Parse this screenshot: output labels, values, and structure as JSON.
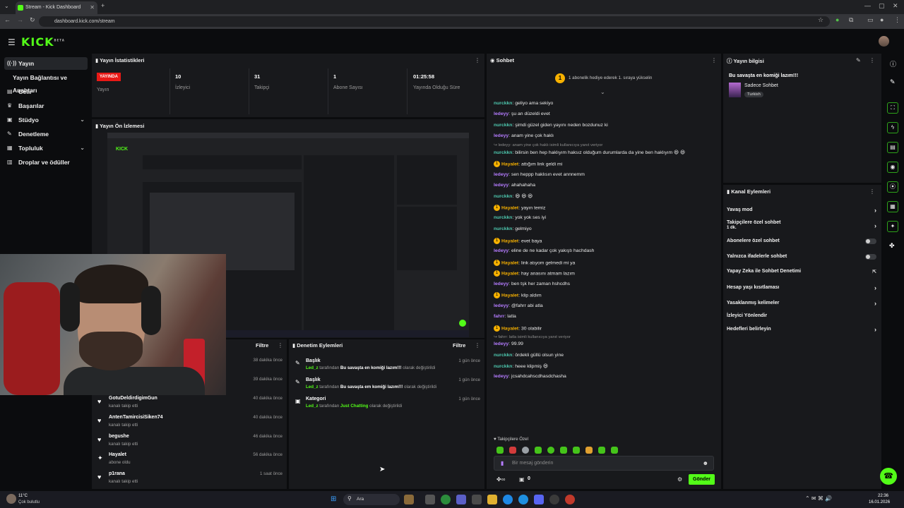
{
  "browser": {
    "tab_title": "Stream - Kick Dashboard",
    "url": "dashboard.kick.com/stream"
  },
  "header": {
    "logo": "KICK",
    "logo_sup": "BETA"
  },
  "sidebar": {
    "items": [
      {
        "label": "Yayın",
        "icon": "broadcast-icon"
      },
      {
        "label": "Yayın Bağlantısı ve Anahtarı",
        "icon": ""
      },
      {
        "label": "Gelir",
        "icon": "money-icon"
      },
      {
        "label": "Başarılar",
        "icon": "trophy-icon"
      },
      {
        "label": "Stüdyo",
        "icon": "studio-icon"
      },
      {
        "label": "Denetleme",
        "icon": "wrench-icon"
      },
      {
        "label": "Topluluk",
        "icon": "community-icon"
      },
      {
        "label": "Droplar ve ödüller",
        "icon": "gift-icon"
      }
    ]
  },
  "stats": {
    "title": "Yayın İstatistikleri",
    "live_badge": "YAYINDA",
    "live_label": "Yayın",
    "items": [
      {
        "value": "10",
        "label": "İzleyici"
      },
      {
        "value": "31",
        "label": "Takipçi"
      },
      {
        "value": "1",
        "label": "Abone Sayısı"
      },
      {
        "value": "01:25:58",
        "label": "Yayında Olduğu Süre"
      }
    ]
  },
  "preview": {
    "title": "Yayın Ön İzlemesi"
  },
  "activity": {
    "filter": "Filtre",
    "items": [
      {
        "name": "",
        "sub": "",
        "time": "38 dakika önce"
      },
      {
        "name": "",
        "sub": "",
        "time": "39 dakika önce"
      },
      {
        "name": "GotuDeldirdigimGun",
        "sub": "kanalı takip etti",
        "time": "40 dakika önce"
      },
      {
        "name": "AntenTamircisiSiken74",
        "sub": "kanalı takip etti",
        "time": "40 dakika önce"
      },
      {
        "name": "begushe",
        "sub": "kanalı takip etti",
        "time": "46 dakika önce"
      },
      {
        "name": "Hayalet",
        "sub": "abone oldu",
        "time": "56 dakika önce"
      },
      {
        "name": "p1rana",
        "sub": "kanalı takip etti",
        "time": "1 saat önce"
      }
    ]
  },
  "mod_actions": {
    "title": "Denetim Eylemleri",
    "filter": "Filtre",
    "items": [
      {
        "type": "Başlık",
        "user": "Led_z",
        "mid": "tarafından",
        "value": "Bu savaşta en komiği lazım!!!",
        "end": "olarak değiştirildi",
        "time": "1 gün önce"
      },
      {
        "type": "Başlık",
        "user": "Led_z",
        "mid": "tarafından",
        "value": "Bu savaşta em komiği lazım!!!",
        "end": "olarak değiştirildi",
        "time": "1 gün önce"
      },
      {
        "type": "Kategori",
        "user": "Led_z",
        "mid": "tarafından",
        "value": "Just Chatting",
        "end": "olarak değiştirildi",
        "time": "1 gün önce"
      }
    ]
  },
  "chat": {
    "title": "Sohbet",
    "pinned": "1 abonelik hediye ederek 1. sıraya yükselin",
    "messages": [
      {
        "user": "nurckkn",
        "color": "#4ec9b0",
        "text": "geliyo ama sekiyo"
      },
      {
        "user": "ledeyy",
        "color": "#b57cff",
        "text": "şu an düzeldi evet"
      },
      {
        "user": "nurckkn",
        "color": "#4ec9b0",
        "text": "şimdi güzel giden yayını neden bozdunuz ki"
      },
      {
        "user": "ledeyy",
        "color": "#b57cff",
        "text": "anam yine çok haklı"
      },
      {
        "reply": "ledeyy: anam yine çok haklı isimli kullanıcıya yanıt veriyor"
      },
      {
        "user": "nurckkn",
        "color": "#4ec9b0",
        "text": "bilirsin ben hep haklıyım haksız olduğum durumlarda da yine ben haklıyım 😆 😆"
      },
      {
        "user": "Hayalet",
        "color": "#f7b100",
        "badge": true,
        "text": "attığım link geldi mi"
      },
      {
        "user": "ledeyy",
        "color": "#b57cff",
        "text": "sen heppp haklısın evet annnemm"
      },
      {
        "user": "ledeyy",
        "color": "#b57cff",
        "text": "ahahahaha"
      },
      {
        "user": "nurckkn",
        "color": "#4ec9b0",
        "text": "😆 😆 😆"
      },
      {
        "user": "Hayalet",
        "color": "#f7b100",
        "badge": true,
        "text": "yayın temiz"
      },
      {
        "user": "nurckkn",
        "color": "#4ec9b0",
        "text": "yok yok ses iyi"
      },
      {
        "user": "nurckkn",
        "color": "#4ec9b0",
        "text": "gelmiyo"
      },
      {
        "user": "Hayalet",
        "color": "#f7b100",
        "badge": true,
        "text": "evet baya"
      },
      {
        "user": "ledeyy",
        "color": "#b57cff",
        "text": "eline de ne kadar çok yakıştı hachdash"
      },
      {
        "user": "Hayalet",
        "color": "#f7b100",
        "badge": true,
        "text": "link atıyom gelmedi mi ya"
      },
      {
        "user": "Hayalet",
        "color": "#f7b100",
        "badge": true,
        "text": "hay anasını atmam lazım"
      },
      {
        "user": "ledeyy",
        "color": "#b57cff",
        "text": "ben tşk her zaman hshcdhs"
      },
      {
        "user": "Hayalet",
        "color": "#f7b100",
        "badge": true,
        "text": "klip aldım"
      },
      {
        "user": "ledeyy",
        "color": "#b57cff",
        "text": "@fahrr abi atla"
      },
      {
        "user": "fahrr",
        "color": "#b57cff",
        "text": "latla"
      },
      {
        "user": "Hayalet",
        "color": "#f7b100",
        "badge": true,
        "text": "30 olabilir"
      },
      {
        "reply": "fahrr: latla isimli kullanıcıya yanıt veriyor"
      },
      {
        "user": "ledeyy",
        "color": "#b57cff",
        "text": "99.99"
      },
      {
        "user": "nurckkn",
        "color": "#4ec9b0",
        "text": "ördekli güllü olsun yine"
      },
      {
        "user": "nurckkn",
        "color": "#4ec9b0",
        "text": "heee klipmiş 😆"
      },
      {
        "user": "ledeyy",
        "color": "#b57cff",
        "text": "jcsahdcahscdhasdchasha"
      }
    ],
    "followers_only": "Takipçilere Özel",
    "input_placeholder": "Bir mesaj gönderin",
    "count": "0",
    "send": "Gönder"
  },
  "stream_info": {
    "title": "Yayın bilgisi",
    "stream_title": "Bu savaşta en komiği lazım!!!",
    "category": "Sadece Sohbet",
    "tag": "Turkish"
  },
  "channel_actions": {
    "title": "Kanal Eylemleri",
    "items": [
      {
        "label": "Yavaş mod",
        "control": "arrow"
      },
      {
        "label": "Takipçilere özel sohbet",
        "sub": "1 dk.",
        "control": "arrow"
      },
      {
        "label": "Abonelere özel sohbet",
        "control": "toggle"
      },
      {
        "label": "Yalnızca ifadelerle sohbet",
        "control": "toggle"
      },
      {
        "label": "Yapay Zeka ile Sohbet Denetimi",
        "control": "external"
      },
      {
        "label": "Hesap yaşı kısıtlaması",
        "control": "arrow"
      },
      {
        "label": "Yasaklanmış kelimeler",
        "control": "arrow"
      },
      {
        "label": "İzleyici Yönlendir",
        "control": "none"
      },
      {
        "label": "Hedefleri belirleyin",
        "control": "arrow"
      }
    ]
  },
  "taskbar": {
    "weather_temp": "11°C",
    "weather_text": "Çok bulutlu",
    "search": "Ara",
    "time": "22:36",
    "date": "16.01.2026"
  },
  "colors": {
    "accent": "#53fc18",
    "live": "#e91916",
    "panel": "#18191c"
  }
}
